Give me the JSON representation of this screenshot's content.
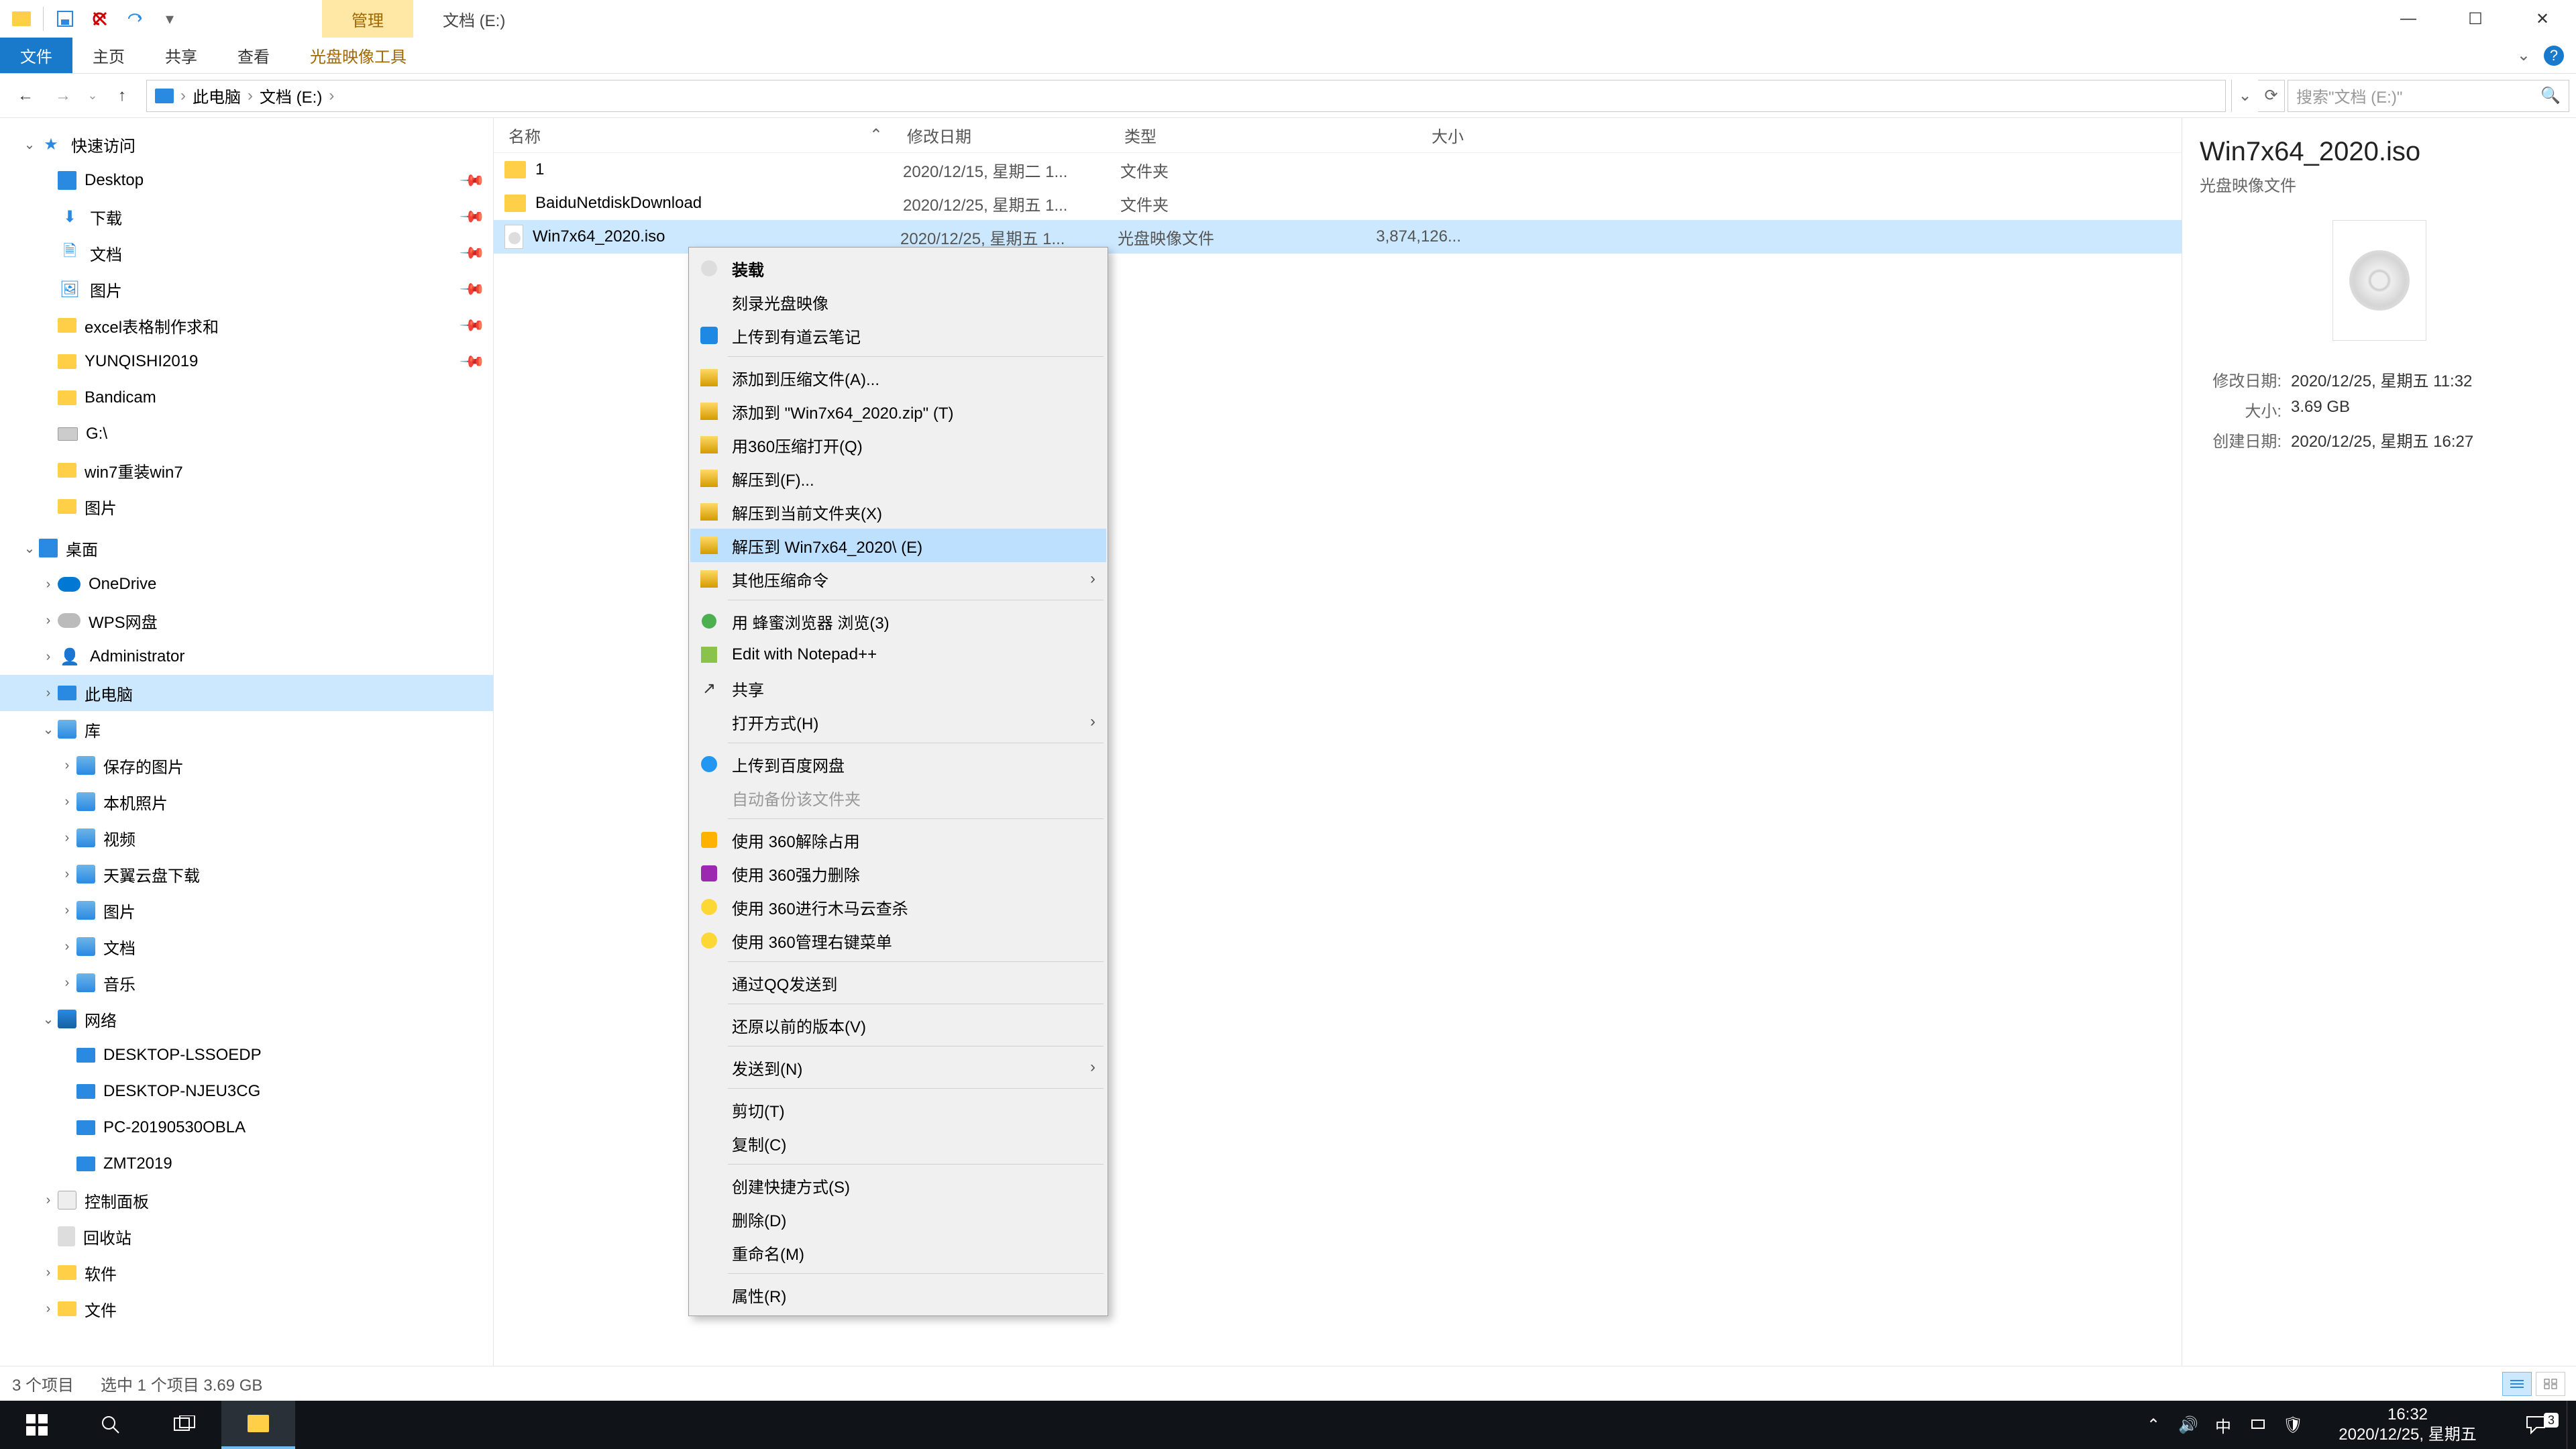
{
  "titlebar": {
    "manage_tab": "管理",
    "title": "文档 (E:)"
  },
  "ribbon": {
    "file": "文件",
    "home": "主页",
    "share": "共享",
    "view": "查看",
    "disc_tools": "光盘映像工具"
  },
  "addr": {
    "root": "此电脑",
    "folder": "文档 (E:)",
    "search_placeholder": "搜索\"文档 (E:)\""
  },
  "nav": {
    "quick": "快速访问",
    "desktop": "Desktop",
    "downloads": "下载",
    "documents": "文档",
    "pictures": "图片",
    "excel": "excel表格制作求和",
    "yunqishi": "YUNQISHI2019",
    "bandicam": "Bandicam",
    "g_drive": "G:\\",
    "win7_reinstall": "win7重装win7",
    "pictures2": "图片",
    "desktop_cn": "桌面",
    "onedrive": "OneDrive",
    "wps": "WPS网盘",
    "admin": "Administrator",
    "thispc": "此电脑",
    "libraries": "库",
    "saved_pics": "保存的图片",
    "camera_roll": "本机照片",
    "videos": "视频",
    "tianyi": "天翼云盘下载",
    "pics_lib": "图片",
    "docs_lib": "文档",
    "music_lib": "音乐",
    "network": "网络",
    "pc1": "DESKTOP-LSSOEDP",
    "pc2": "DESKTOP-NJEU3CG",
    "pc3": "PC-20190530OBLA",
    "pc4": "ZMT2019",
    "ctrlpanel": "控制面板",
    "recycle": "回收站",
    "software": "软件",
    "files": "文件"
  },
  "cols": {
    "name": "名称",
    "date": "修改日期",
    "type": "类型",
    "size": "大小"
  },
  "rows": [
    {
      "name": "1",
      "date": "2020/12/15, 星期二 1...",
      "type": "文件夹",
      "size": ""
    },
    {
      "name": "BaiduNetdiskDownload",
      "date": "2020/12/25, 星期五 1...",
      "type": "文件夹",
      "size": ""
    },
    {
      "name": "Win7x64_2020.iso",
      "date": "2020/12/25, 星期五 1...",
      "type": "光盘映像文件",
      "size": "3,874,126..."
    }
  ],
  "ctx": {
    "mount": "装载",
    "burn": "刻录光盘映像",
    "youdao": "上传到有道云笔记",
    "add_archive": "添加到压缩文件(A)...",
    "add_zip": "添加到 \"Win7x64_2020.zip\" (T)",
    "open_360": "用360压缩打开(Q)",
    "extract_to": "解压到(F)...",
    "extract_here": "解压到当前文件夹(X)",
    "extract_named": "解压到 Win7x64_2020\\ (E)",
    "other_compress": "其他压缩命令",
    "honey": "用 蜂蜜浏览器 浏览(3)",
    "npp": "Edit with Notepad++",
    "share": "共享",
    "open_with": "打开方式(H)",
    "baidu": "上传到百度网盘",
    "auto_backup": "自动备份该文件夹",
    "u360_unlock": "使用 360解除占用",
    "u360_delete": "使用 360强力删除",
    "u360_scan": "使用 360进行木马云查杀",
    "u360_ctx": "使用 360管理右键菜单",
    "qq": "通过QQ发送到",
    "restore": "还原以前的版本(V)",
    "send_to": "发送到(N)",
    "cut": "剪切(T)",
    "copy": "复制(C)",
    "shortcut": "创建快捷方式(S)",
    "delete": "删除(D)",
    "rename": "重命名(M)",
    "props": "属性(R)"
  },
  "details": {
    "title": "Win7x64_2020.iso",
    "subtitle": "光盘映像文件",
    "mod_label": "修改日期:",
    "mod_val": "2020/12/25, 星期五 11:32",
    "size_label": "大小:",
    "size_val": "3.69 GB",
    "created_label": "创建日期:",
    "created_val": "2020/12/25, 星期五 16:27"
  },
  "status": {
    "count": "3 个项目",
    "selected": "选中 1 个项目  3.69 GB"
  },
  "taskbar": {
    "time": "16:32",
    "date": "2020/12/25, 星期五",
    "ime": "中",
    "notif_count": "3"
  }
}
